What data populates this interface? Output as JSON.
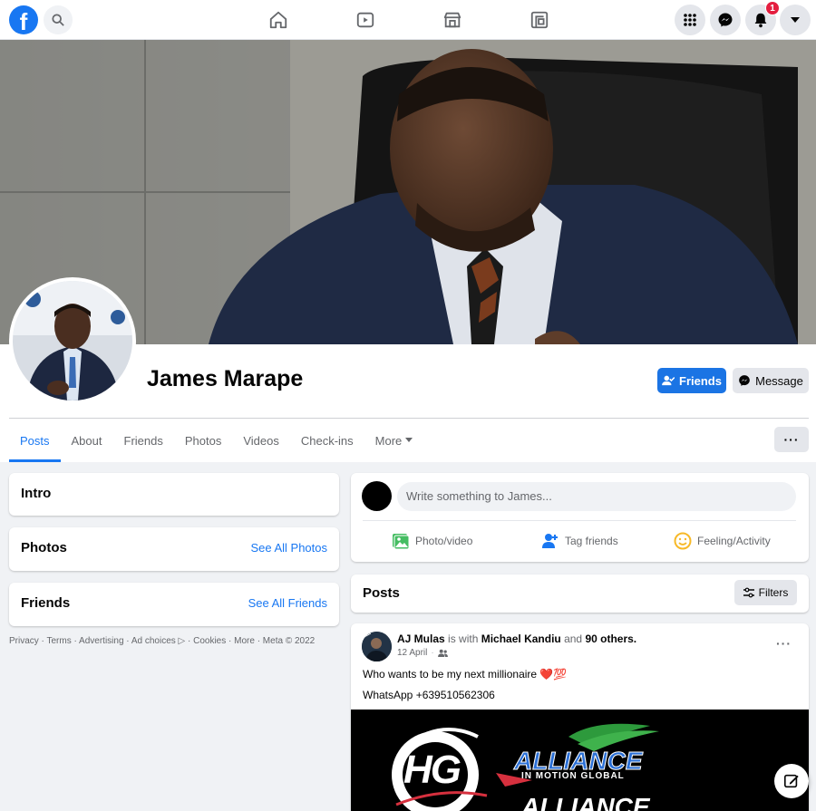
{
  "topbar": {
    "logo_letter": "f",
    "logo_icon": "facebook-logo",
    "nav_icons": [
      "home-icon",
      "watch-icon",
      "marketplace-icon",
      "gaming-icon"
    ],
    "right_icons": [
      "menu-grid-icon",
      "messenger-icon",
      "bell-icon",
      "caret-down-icon"
    ],
    "notification_count": "1"
  },
  "profile": {
    "name": "James Marape",
    "friends_button": "Friends",
    "message_button": "Message",
    "more_button": "···"
  },
  "tabs": [
    {
      "label": "Posts",
      "active": true
    },
    {
      "label": "About"
    },
    {
      "label": "Friends"
    },
    {
      "label": "Photos"
    },
    {
      "label": "Videos"
    },
    {
      "label": "Check-ins"
    },
    {
      "label": "More"
    }
  ],
  "left": {
    "intro_title": "Intro",
    "photos_title": "Photos",
    "photos_link": "See All Photos",
    "friends_title": "Friends",
    "friends_link": "See All Friends",
    "footer": "Privacy · Terms · Advertising · Ad choices ▷ · Cookies · More · Meta © 2022"
  },
  "composer": {
    "placeholder": "Write something to James...",
    "photo_video": "Photo/video",
    "tag_friends": "Tag friends",
    "feeling": "Feeling/Activity"
  },
  "posts_header": {
    "title": "Posts",
    "filters": "Filters"
  },
  "post": {
    "author": "AJ Mulas",
    "is_with": "is with",
    "tagged": "Michael Kandiu",
    "and": "and",
    "others": "90 others.",
    "date": "12 April",
    "line1": "Who wants to be my next millionaire",
    "line1_emoji": "❤️💯",
    "line2": "WhatsApp +639510562306",
    "image_logo_left": "HG",
    "image_logo_right_top": "ALLIANCE",
    "image_logo_right_sub": "IN MOTION GLOBAL",
    "image_logo_right_bottom": "ALLIANCE"
  },
  "colors": {
    "brand": "#1877f2",
    "badge": "#e41e3f",
    "background": "#f0f2f5"
  }
}
